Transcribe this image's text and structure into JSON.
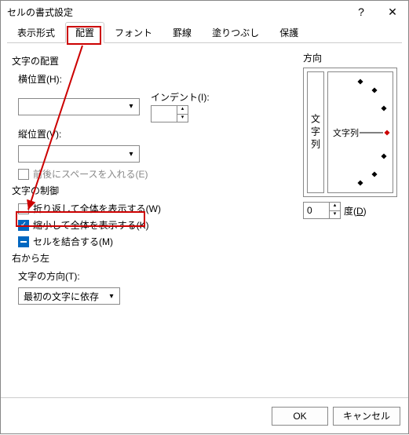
{
  "window": {
    "title": "セルの書式設定"
  },
  "tabs": [
    "表示形式",
    "配置",
    "フォント",
    "罫線",
    "塗りつぶし",
    "保護"
  ],
  "align": {
    "groupTitle": "文字の配置",
    "horizLabel": "横位置(H):",
    "horizValue": "",
    "indentLabel": "インデント(I):",
    "indentValue": "",
    "vertLabel": "縦位置(V):",
    "vertValue": "",
    "distributedLabel": "前後にスペースを入れる(E)"
  },
  "control": {
    "groupTitle": "文字の制御",
    "wrapLabel": "折り返して全体を表示する(W)",
    "shrinkLabel": "縮小して全体を表示する(K)",
    "mergeLabel": "セルを結合する(M)"
  },
  "rtl": {
    "groupTitle": "右から左",
    "dirLabel": "文字の方向(T):",
    "dirValue": "最初の文字に依存"
  },
  "orient": {
    "groupTitle": "方向",
    "vertText": "文字列",
    "dialText": "文字列",
    "degValue": "0",
    "degLabel": "度(D)"
  },
  "buttons": {
    "ok": "OK",
    "cancel": "キャンセル"
  }
}
